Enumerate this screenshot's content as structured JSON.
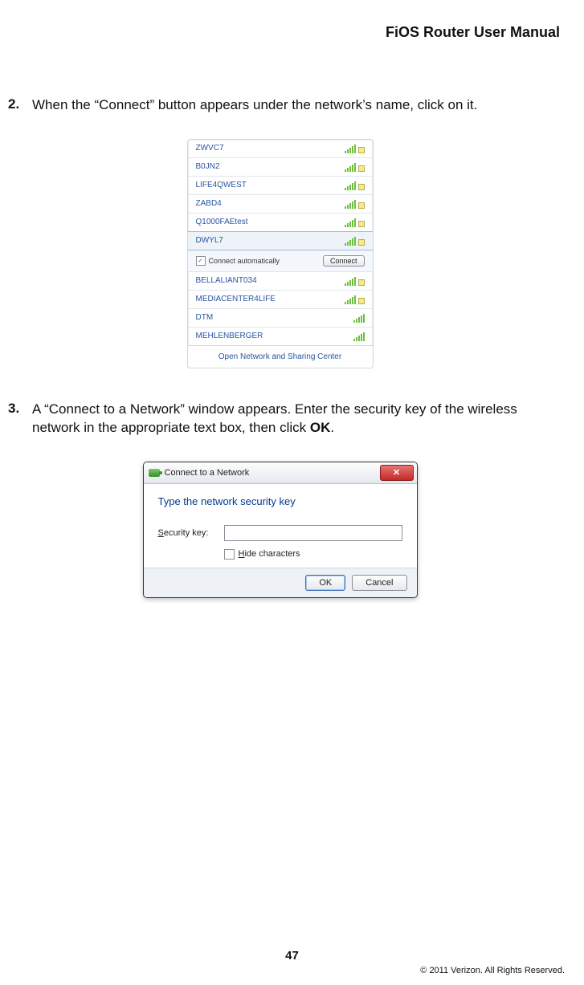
{
  "header": {
    "title": "FiOS Router User Manual"
  },
  "steps": {
    "s2": {
      "num": "2.",
      "text": "When the “Connect” button appears under the network’s name, click on it."
    },
    "s3": {
      "num": "3.",
      "text": "A “Connect to a Network” window appears. Enter the security key of the wireless network in the appropriate text box, then click ",
      "bold": "OK",
      "after": "."
    }
  },
  "flyout": {
    "networks": [
      {
        "name": "ZWVC7",
        "locked": true
      },
      {
        "name": "B0JN2",
        "locked": true
      },
      {
        "name": "LIFE4QWEST",
        "locked": true
      },
      {
        "name": "ZABD4",
        "locked": true
      },
      {
        "name": "Q1000FAEtest",
        "locked": true
      }
    ],
    "selected": {
      "name": "DWYL7",
      "locked": true
    },
    "auto_label": "Connect automatically",
    "auto_checked": "✓",
    "connect_label": "Connect",
    "below": [
      {
        "name": "BELLALIANT034",
        "locked": true
      },
      {
        "name": "MEDIACENTER4LIFE",
        "locked": true
      },
      {
        "name": "DTM",
        "locked": false
      },
      {
        "name": "MEHLENBERGER",
        "locked": false
      }
    ],
    "footer": "Open Network and Sharing Center"
  },
  "dialog": {
    "title": "Connect to a Network",
    "heading": "Type the network security key",
    "field_label_pre": "S",
    "field_label_rest": "ecurity key:",
    "hide_pre": "H",
    "hide_rest": "ide characters",
    "ok": "OK",
    "cancel": "Cancel",
    "close_glyph": "✕"
  },
  "footer": {
    "page": "47",
    "copyright": "© 2011 Verizon. All Rights Reserved."
  }
}
